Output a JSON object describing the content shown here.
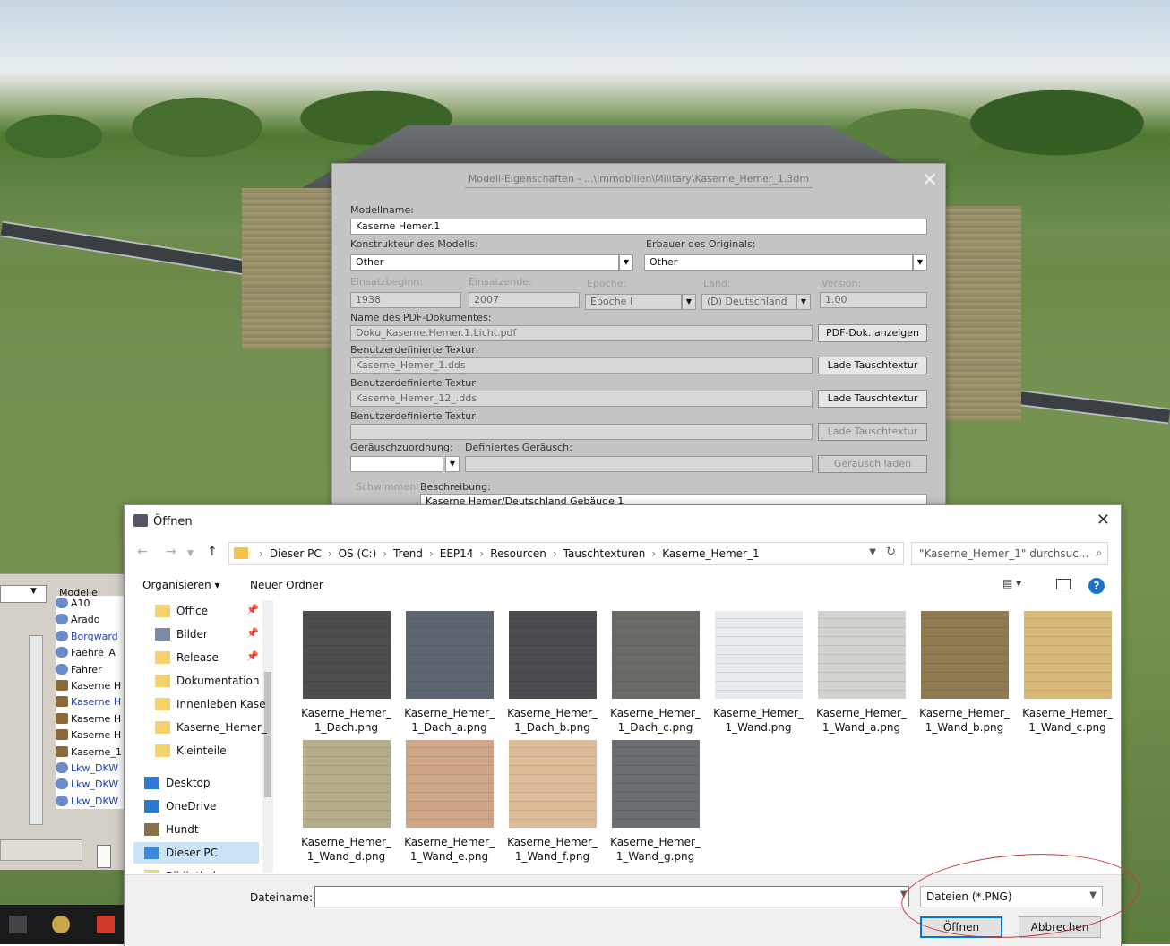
{
  "props": {
    "title": "Modell-Eigenschaften - ...\\Immobilien\\Military\\Kaserne_Hemer_1.3dm",
    "modellname_label": "Modellname:",
    "modellname": "Kaserne Hemer.1",
    "konstrukteur_label": "Konstrukteur des Modells:",
    "konstrukteur": "Other",
    "erbauer_label": "Erbauer des Originals:",
    "erbauer": "Other",
    "einsatzbeginn_label": "Einsatzbeginn:",
    "einsatzbeginn": "1938",
    "einsatzende_label": "Einsatzende:",
    "einsatzende": "2007",
    "epoche_label": "Epoche:",
    "epoche": "Epoche I",
    "land_label": "Land:",
    "land": "(D) Deutschland",
    "version_label": "Version:",
    "version": "1.00",
    "pdf_label": "Name des PDF-Dokumentes:",
    "pdf": "Doku_Kaserne.Hemer.1.Licht.pdf",
    "pdf_button": "PDF-Dok. anzeigen",
    "textur_label": "Benutzerdefinierte Textur:",
    "textur1": "Kaserne_Hemer_1.dds",
    "textur2": "Kaserne_Hemer_12_.dds",
    "textur3": "",
    "lade_button": "Lade Tauschtextur",
    "geraeusch_label": "Geräuschzuordnung:",
    "def_geraeusch_label": "Definiertes Geräusch:",
    "geraeusch_button": "Geräusch laden",
    "schwimmen_label": "Schwimmen:",
    "beschreibung_label": "Beschreibung:",
    "beschreibung": "Kaserne Hemer/Deutschland Gebäude 1"
  },
  "left_panel": {
    "header": "Modelle",
    "items": [
      "A10",
      "Arado",
      "Borgward",
      "Faehre_A",
      "Fahrer",
      "Kaserne H",
      "Kaserne H",
      "Kaserne H",
      "Kaserne H",
      "Kaserne_1",
      "Lkw_DKW",
      "Lkw_DKW",
      "Lkw_DKW"
    ]
  },
  "open_dialog": {
    "title": "Öffnen",
    "breadcrumb": [
      "Dieser PC",
      "OS (C:)",
      "Trend",
      "EEP14",
      "Resourcen",
      "Tauschtexturen",
      "Kaserne_Hemer_1"
    ],
    "search_placeholder": "\"Kaserne_Hemer_1\" durchsuc...",
    "organize": "Organisieren ▾",
    "new_folder": "Neuer Ordner",
    "nav_items": [
      {
        "label": "Office",
        "type": "folder",
        "pinned": true
      },
      {
        "label": "Bilder",
        "type": "pictures",
        "pinned": true
      },
      {
        "label": "Release",
        "type": "folder",
        "pinned": true
      },
      {
        "label": "Dokumentation",
        "type": "folder",
        "pinned": false
      },
      {
        "label": "Innenleben Kase",
        "type": "folder",
        "pinned": false
      },
      {
        "label": "Kaserne_Hemer_",
        "type": "folder",
        "pinned": false
      },
      {
        "label": "Kleinteile",
        "type": "folder",
        "pinned": false
      },
      {
        "label": "Desktop",
        "type": "desktop",
        "pinned": false
      },
      {
        "label": "OneDrive",
        "type": "cloud",
        "pinned": false
      },
      {
        "label": "Hundt",
        "type": "user",
        "pinned": false
      },
      {
        "label": "Dieser PC",
        "type": "pc",
        "pinned": false,
        "selected": true
      },
      {
        "label": "Bibliotheken",
        "type": "folder",
        "pinned": false
      }
    ],
    "files": [
      {
        "line1": "Kaserne_Hemer_",
        "line2": "1_Dach.png",
        "color": "#4e4e4e"
      },
      {
        "line1": "Kaserne_Hemer_",
        "line2": "1_Dach_a.png",
        "color": "#5d6670"
      },
      {
        "line1": "Kaserne_Hemer_",
        "line2": "1_Dach_b.png",
        "color": "#4b4d50"
      },
      {
        "line1": "Kaserne_Hemer_",
        "line2": "1_Dach_c.png",
        "color": "#6b6b66"
      },
      {
        "line1": "Kaserne_Hemer_",
        "line2": "1_Wand.png",
        "color": "#e9ecef"
      },
      {
        "line1": "Kaserne_Hemer_",
        "line2": "1_Wand_a.png",
        "color": "#d2d2cf"
      },
      {
        "line1": "Kaserne_Hemer_",
        "line2": "1_Wand_b.png",
        "color": "#8f7a52"
      },
      {
        "line1": "Kaserne_Hemer_",
        "line2": "1_Wand_c.png",
        "color": "#d9b979"
      },
      {
        "line1": "Kaserne_Hemer_",
        "line2": "1_Wand_d.png",
        "color": "#b5ac8a"
      },
      {
        "line1": "Kaserne_Hemer_",
        "line2": "1_Wand_e.png",
        "color": "#cfa588"
      },
      {
        "line1": "Kaserne_Hemer_",
        "line2": "1_Wand_f.png",
        "color": "#dcbc98"
      },
      {
        "line1": "Kaserne_Hemer_",
        "line2": "1_Wand_g.png",
        "color": "#6a6d72"
      }
    ],
    "filename_label": "Dateiname:",
    "filename_value": "",
    "filetype": "Dateien (*.PNG)",
    "open_button": "Öffnen",
    "cancel_button": "Abbrechen"
  },
  "colors": {
    "accent": "#0078d7",
    "annotation": "#c43a3a"
  }
}
